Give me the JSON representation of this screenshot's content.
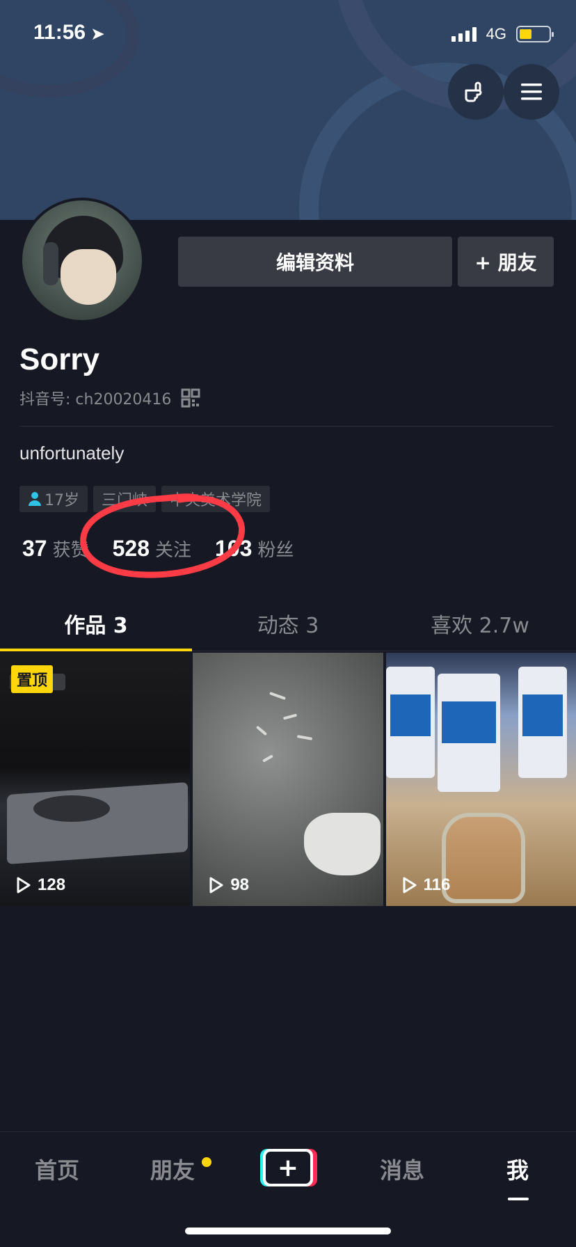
{
  "status_bar": {
    "time": "11:56",
    "network": "4G"
  },
  "profile": {
    "edit_label": "编辑资料",
    "add_friend_label": "+ 朋友",
    "name": "Sorry",
    "douyin_id": "抖音号: ch20020416",
    "bio": "unfortunately",
    "tags": [
      "17岁",
      "三门峡",
      "中央美术学院"
    ],
    "stats": [
      {
        "num": "37",
        "label": "获赞"
      },
      {
        "num": "528",
        "label": "关注"
      },
      {
        "num": "103",
        "label": "粉丝"
      }
    ]
  },
  "tabs": [
    {
      "label": "作品 3"
    },
    {
      "label": "动态 3"
    },
    {
      "label": "喜欢 2.7w"
    }
  ],
  "videos": [
    {
      "plays": "128",
      "pinned_label": "置顶"
    },
    {
      "plays": "98"
    },
    {
      "plays": "116"
    }
  ],
  "bottom_nav": {
    "home": "首页",
    "friends": "朋友",
    "create": "+",
    "messages": "消息",
    "me": "我"
  },
  "colors": {
    "background": "#161823",
    "accent": "#ffd60a",
    "annotation": "#ff3b46"
  }
}
